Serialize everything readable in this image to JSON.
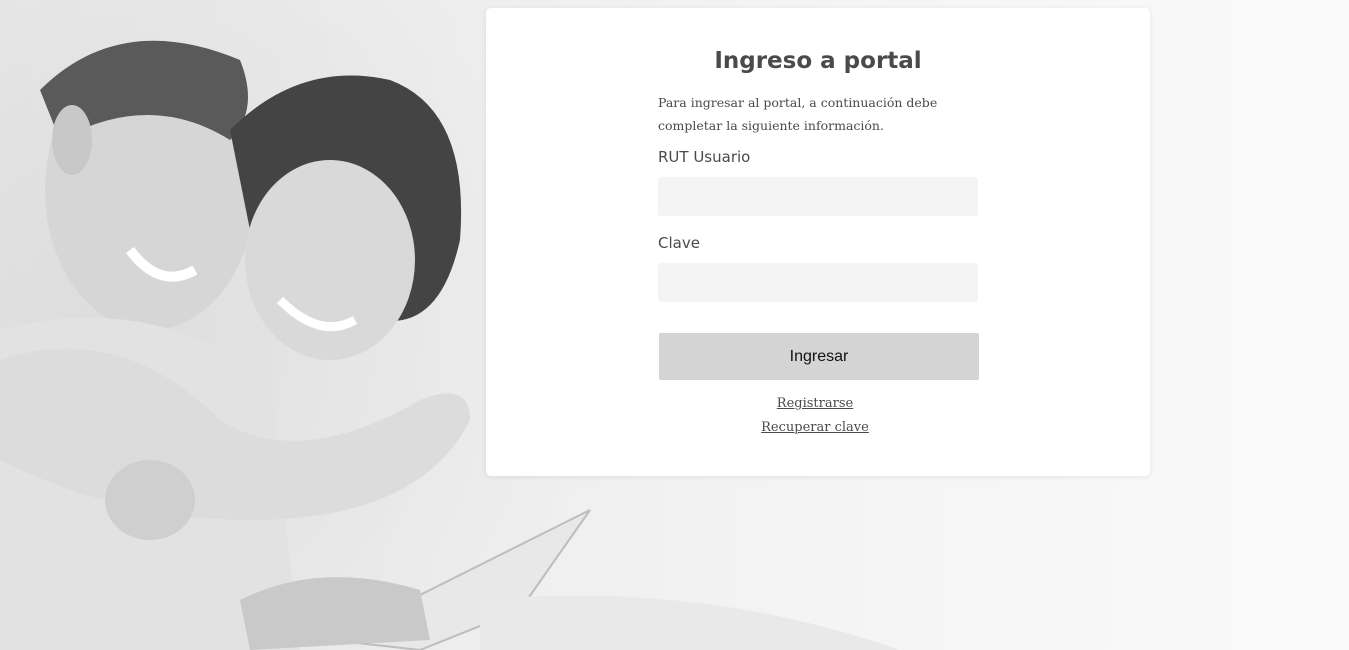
{
  "login": {
    "title": "Ingreso a portal",
    "intro_line1": "Para ingresar al portal,  a continuación debe",
    "intro_line2": "completar la siguiente información.",
    "rut_label": "RUT Usuario",
    "rut_value": "",
    "clave_label": "Clave",
    "clave_value": "",
    "submit_label": "Ingresar",
    "register_link": "Registrarse",
    "recover_link": "Recuperar clave"
  },
  "colors": {
    "card_bg": "#ffffff",
    "button_bg": "#d4d4d4",
    "input_bg": "#f4f4f4",
    "text": "#4a4a4a"
  }
}
